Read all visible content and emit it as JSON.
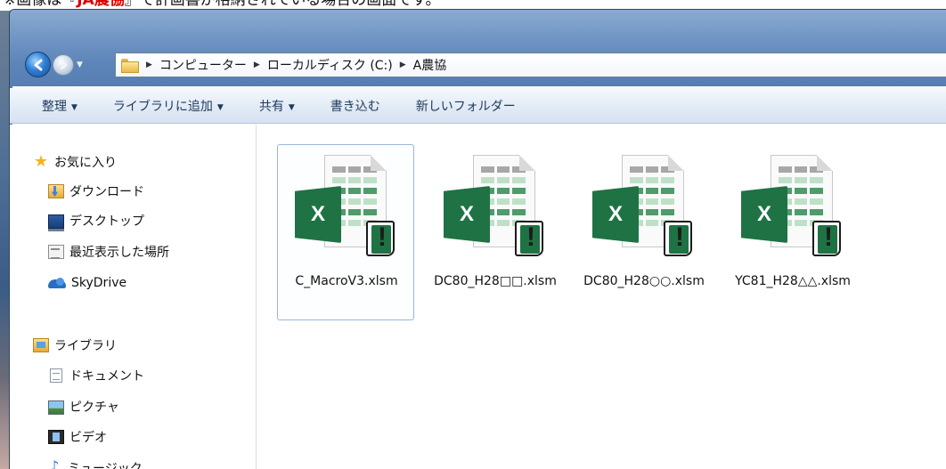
{
  "caption": {
    "prefix": "※画像は『",
    "highlight": "JA農協",
    "suffix": "』で計画書が格納されている場合の画面です。"
  },
  "address_bar": {
    "crumbs": [
      "コンピューター",
      "ローカルディスク (C:)",
      "A農協"
    ]
  },
  "toolbar": {
    "organize": "整理",
    "add_to_library": "ライブラリに追加",
    "share": "共有",
    "burn": "書き込む",
    "new_folder": "新しいフォルダー"
  },
  "nav_pane": {
    "favorites": "お気に入り",
    "downloads": "ダウンロード",
    "desktop": "デスクトップ",
    "recent_places": "最近表示した場所",
    "skydrive": "SkyDrive",
    "libraries": "ライブラリ",
    "documents": "ドキュメント",
    "pictures": "ピクチャ",
    "videos": "ビデオ",
    "music": "ミュージック"
  },
  "files": [
    {
      "name": "C_MacroV3.xlsm",
      "selected": true,
      "icon": "excel-macro-icon"
    },
    {
      "name": "DC80_H28□□.xlsm",
      "selected": false,
      "icon": "excel-macro-icon"
    },
    {
      "name": "DC80_H28○○.xlsm",
      "selected": false,
      "icon": "excel-macro-icon"
    },
    {
      "name": "YC81_H28△△.xlsm",
      "selected": false,
      "icon": "excel-macro-icon"
    }
  ],
  "colors": {
    "highlight_text": "#e00000",
    "excel_green": "#1f7244",
    "toolbar_text": "#1e395b",
    "selection_border": "#99b7d9"
  }
}
